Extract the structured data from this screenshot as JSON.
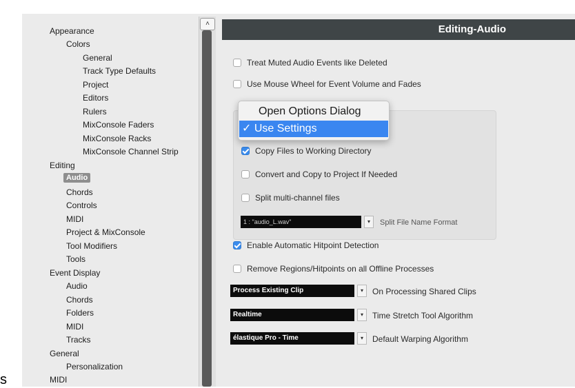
{
  "sidebar": {
    "items": [
      {
        "label": "Appearance",
        "level": 0
      },
      {
        "label": "Colors",
        "level": 1
      },
      {
        "label": "General",
        "level": 2
      },
      {
        "label": "Track Type Defaults",
        "level": 2
      },
      {
        "label": "Project",
        "level": 2
      },
      {
        "label": "Editors",
        "level": 2
      },
      {
        "label": "Rulers",
        "level": 2
      },
      {
        "label": "MixConsole Faders",
        "level": 2
      },
      {
        "label": "MixConsole Racks",
        "level": 2
      },
      {
        "label": "MixConsole Channel Strip",
        "level": 2
      },
      {
        "label": "Editing",
        "level": 0
      },
      {
        "label": "Audio",
        "level": 1,
        "selected": true
      },
      {
        "label": "Chords",
        "level": 1
      },
      {
        "label": "Controls",
        "level": 1
      },
      {
        "label": "MIDI",
        "level": 1
      },
      {
        "label": "Project & MixConsole",
        "level": 1
      },
      {
        "label": "Tool Modifiers",
        "level": 1
      },
      {
        "label": "Tools",
        "level": 1
      },
      {
        "label": "Event Display",
        "level": 0
      },
      {
        "label": "Audio",
        "level": 1
      },
      {
        "label": "Chords",
        "level": 1
      },
      {
        "label": "Folders",
        "level": 1
      },
      {
        "label": "MIDI",
        "level": 1
      },
      {
        "label": "Tracks",
        "level": 1
      },
      {
        "label": "General",
        "level": 0
      },
      {
        "label": "Personalization",
        "level": 1
      },
      {
        "label": "MIDI",
        "level": 0
      }
    ],
    "scroll_up_glyph": "˄"
  },
  "stray_text": "s",
  "panel": {
    "title": "Editing-Audio",
    "options": {
      "treat_muted": {
        "label": "Treat Muted Audio Events like Deleted",
        "checked": false
      },
      "mouse_wheel": {
        "label": "Use Mouse Wheel for Event Volume and Fades",
        "checked": false
      },
      "copy_files": {
        "label": "Copy Files to Working Directory",
        "checked": true
      },
      "convert_copy": {
        "label": "Convert and Copy to Project If Needed",
        "checked": false
      },
      "split_multi": {
        "label": "Split multi-channel files",
        "checked": false
      },
      "auto_hitpoint": {
        "label": "Enable Automatic Hitpoint Detection",
        "checked": true
      },
      "remove_regions": {
        "label": "Remove Regions/Hitpoints on all Offline Processes",
        "checked": false
      }
    },
    "split_format": {
      "value": "1 : \"audio_L.wav\"",
      "label": "Split File Name Format"
    },
    "shared_clips": {
      "value": "Process Existing Clip",
      "label": "On Processing Shared Clips"
    },
    "time_stretch": {
      "value": "Realtime",
      "label": "Time Stretch Tool Algorithm"
    },
    "warping": {
      "value": "élastique Pro - Time",
      "label": "Default Warping Algorithm"
    },
    "dropdown_glyph": "▾"
  },
  "popup_menu": {
    "items": [
      {
        "label": "Open Options Dialog",
        "selected": false
      },
      {
        "label": "✓ Use Settings",
        "selected": true
      }
    ]
  },
  "colors": {
    "header_bg": "#3f4547",
    "checkbox_on": "#3b8ced",
    "menu_highlight": "#3a86f0"
  }
}
